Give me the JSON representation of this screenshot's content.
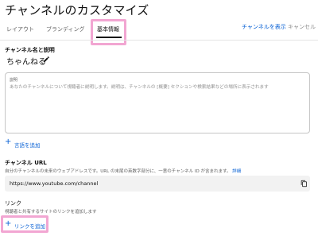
{
  "page": {
    "title": "チャンネルのカスタマイズ"
  },
  "tabs": [
    {
      "label": "レイアウト"
    },
    {
      "label": "ブランディング"
    },
    {
      "label": "基本情報",
      "active": true
    }
  ],
  "actions": {
    "view_channel": "チャンネルを表示",
    "cancel": "キャンセル"
  },
  "name_section": {
    "label": "チャンネル名と説明",
    "channel_name": "ちゃんねる"
  },
  "description": {
    "label": "説明",
    "placeholder": "あなたのチャンネルについて視聴者に説明します。説明は、チャンネルの [概要] セクションや検索結果などの場所に表示されます",
    "add_language": "言語を追加"
  },
  "url_section": {
    "label": "チャンネル URL",
    "help_text": "自分のチャンネルの未来のウェブアドレスです。URL の末尾の英数字部分に、一意のチャンネル ID が含まれます。",
    "help_link": "詳細",
    "url": "https://www.youtube.com/channel"
  },
  "links_section": {
    "label": "リンク",
    "help_text": "視聴者と共有するサイトのリンクを追加します",
    "add_link": "リンクを追加"
  },
  "colors": {
    "accent": "#065fd4",
    "highlight": "#f2a6d2"
  }
}
